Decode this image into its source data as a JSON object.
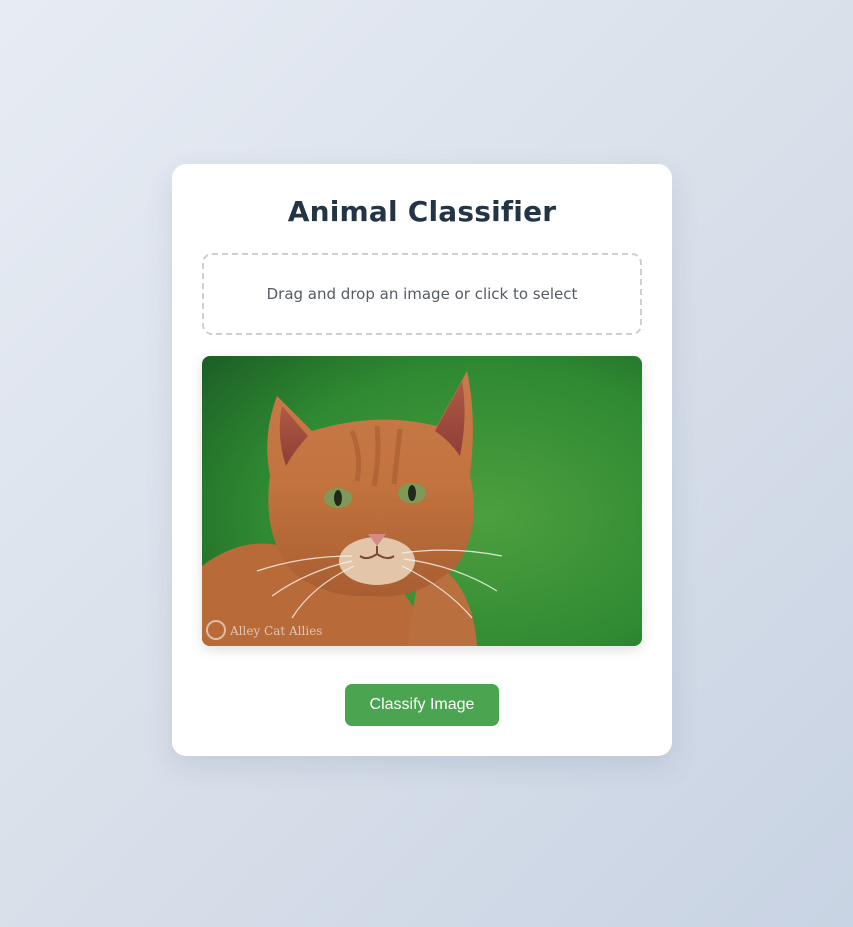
{
  "app": {
    "title": "Animal Classifier"
  },
  "upload": {
    "prompt": "Drag and drop an image or click to select"
  },
  "preview": {
    "watermark": "Alley Cat Allies"
  },
  "actions": {
    "classify_label": "Classify Image"
  },
  "colors": {
    "accent": "#4ba44f",
    "title": "#233446",
    "dropzone_border": "#cfcfcf"
  }
}
